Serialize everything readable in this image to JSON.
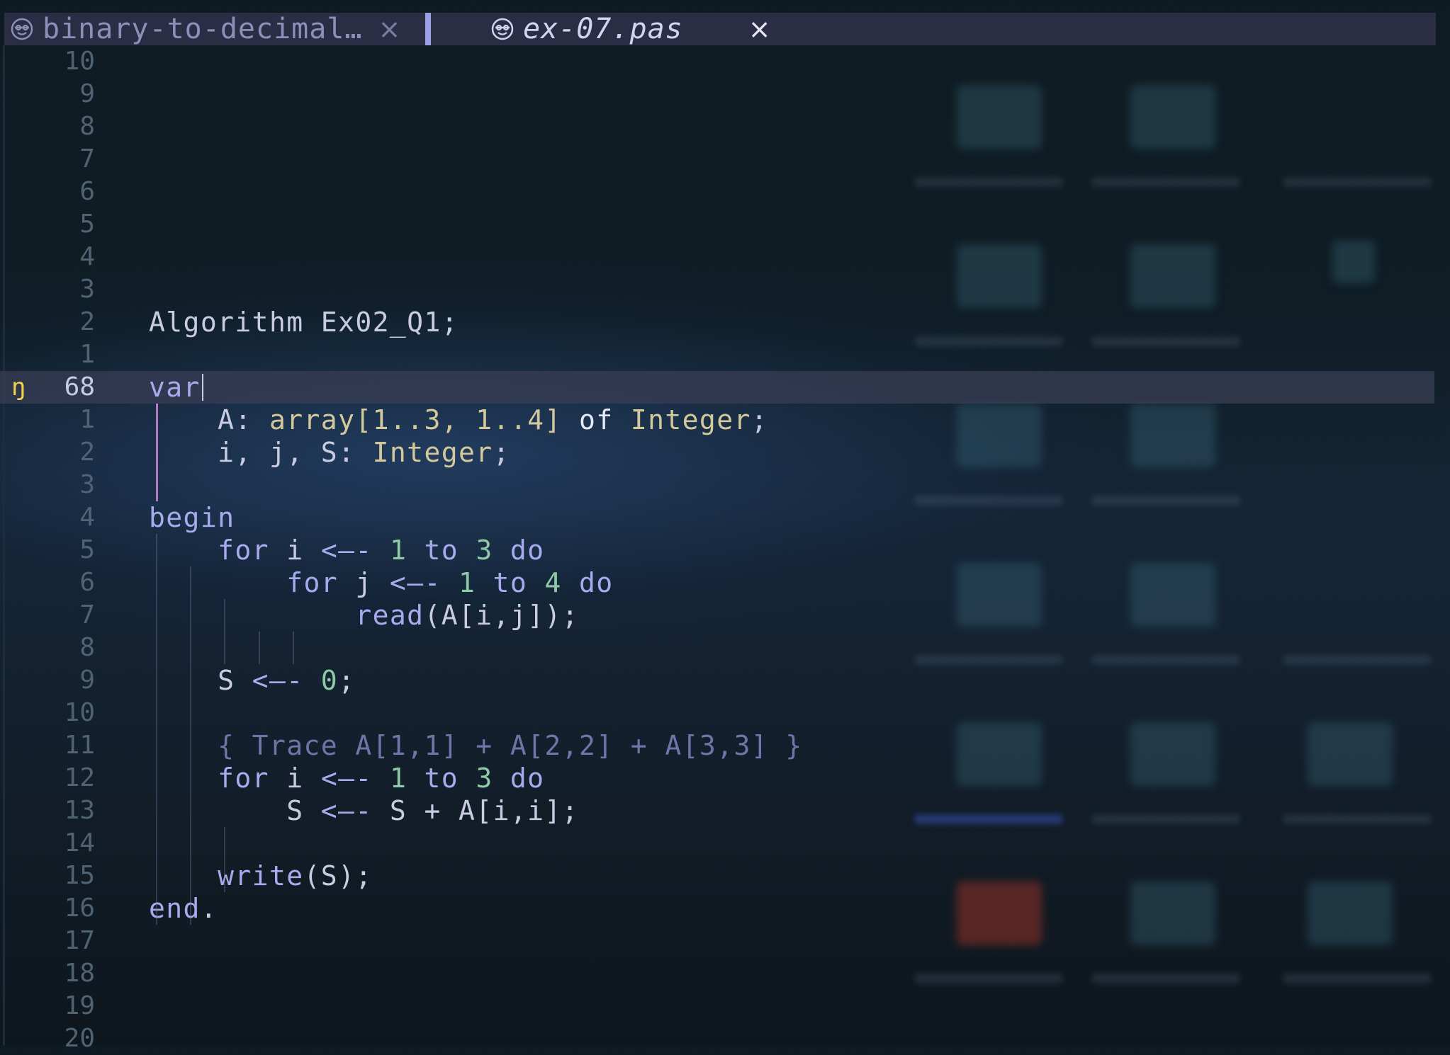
{
  "tabs": [
    {
      "label": "binary-to-decimal…",
      "close": "×",
      "active": false,
      "icon": "pascal-icon"
    },
    {
      "label": "ex-07.pas",
      "close": "×",
      "active": true,
      "icon": "pascal-icon"
    }
  ],
  "editor": {
    "current_line_marker": "ŋ",
    "lines": [
      {
        "num": "10",
        "tokens": []
      },
      {
        "num": "9",
        "tokens": []
      },
      {
        "num": "8",
        "tokens": []
      },
      {
        "num": "7",
        "tokens": []
      },
      {
        "num": "6",
        "tokens": []
      },
      {
        "num": "5",
        "tokens": []
      },
      {
        "num": "4",
        "tokens": []
      },
      {
        "num": "3",
        "tokens": []
      },
      {
        "num": "2",
        "tokens": [
          {
            "t": "Algorithm Ex02_Q1;",
            "c": "plain"
          }
        ]
      },
      {
        "num": "1",
        "tokens": []
      },
      {
        "num": "68",
        "current": true,
        "tokens": [
          {
            "t": "var",
            "c": "kw"
          }
        ]
      },
      {
        "num": "1",
        "tokens": [
          {
            "t": "    A: ",
            "c": "plain"
          },
          {
            "t": "array[1..3, 1..4]",
            "c": "type"
          },
          {
            "t": " ",
            "c": "plain"
          },
          {
            "t": "of",
            "c": "of"
          },
          {
            "t": " ",
            "c": "plain"
          },
          {
            "t": "Integer",
            "c": "type"
          },
          {
            "t": ";",
            "c": "plain"
          }
        ]
      },
      {
        "num": "2",
        "tokens": [
          {
            "t": "    i, j, S: ",
            "c": "plain"
          },
          {
            "t": "Integer",
            "c": "type"
          },
          {
            "t": ";",
            "c": "plain"
          }
        ]
      },
      {
        "num": "3",
        "tokens": []
      },
      {
        "num": "4",
        "tokens": [
          {
            "t": "begin",
            "c": "kw"
          }
        ]
      },
      {
        "num": "5",
        "tokens": [
          {
            "t": "    ",
            "c": "plain"
          },
          {
            "t": "for",
            "c": "kw"
          },
          {
            "t": " i ",
            "c": "plain"
          },
          {
            "t": "<—-",
            "c": "op"
          },
          {
            "t": " ",
            "c": "plain"
          },
          {
            "t": "1",
            "c": "num"
          },
          {
            "t": " ",
            "c": "plain"
          },
          {
            "t": "to",
            "c": "kw"
          },
          {
            "t": " ",
            "c": "plain"
          },
          {
            "t": "3",
            "c": "num"
          },
          {
            "t": " ",
            "c": "plain"
          },
          {
            "t": "do",
            "c": "kw"
          }
        ]
      },
      {
        "num": "6",
        "tokens": [
          {
            "t": "        ",
            "c": "plain"
          },
          {
            "t": "for",
            "c": "kw"
          },
          {
            "t": " j ",
            "c": "plain"
          },
          {
            "t": "<—-",
            "c": "op"
          },
          {
            "t": " ",
            "c": "plain"
          },
          {
            "t": "1",
            "c": "num"
          },
          {
            "t": " ",
            "c": "plain"
          },
          {
            "t": "to",
            "c": "kw"
          },
          {
            "t": " ",
            "c": "plain"
          },
          {
            "t": "4",
            "c": "num"
          },
          {
            "t": " ",
            "c": "plain"
          },
          {
            "t": "do",
            "c": "kw"
          }
        ]
      },
      {
        "num": "7",
        "tokens": [
          {
            "t": "            ",
            "c": "plain"
          },
          {
            "t": "read",
            "c": "kw"
          },
          {
            "t": "(A[i,j]);",
            "c": "plain"
          }
        ]
      },
      {
        "num": "8",
        "tokens": []
      },
      {
        "num": "9",
        "tokens": [
          {
            "t": "    S ",
            "c": "plain"
          },
          {
            "t": "<—-",
            "c": "op"
          },
          {
            "t": " ",
            "c": "plain"
          },
          {
            "t": "0",
            "c": "num"
          },
          {
            "t": ";",
            "c": "plain"
          }
        ]
      },
      {
        "num": "10",
        "tokens": []
      },
      {
        "num": "11",
        "tokens": [
          {
            "t": "    { Trace A[1,1] + A[2,2] + A[3,3] }",
            "c": "com"
          }
        ]
      },
      {
        "num": "12",
        "tokens": [
          {
            "t": "    ",
            "c": "plain"
          },
          {
            "t": "for",
            "c": "kw"
          },
          {
            "t": " i ",
            "c": "plain"
          },
          {
            "t": "<—-",
            "c": "op"
          },
          {
            "t": " ",
            "c": "plain"
          },
          {
            "t": "1",
            "c": "num"
          },
          {
            "t": " ",
            "c": "plain"
          },
          {
            "t": "to",
            "c": "kw"
          },
          {
            "t": " ",
            "c": "plain"
          },
          {
            "t": "3",
            "c": "num"
          },
          {
            "t": " ",
            "c": "plain"
          },
          {
            "t": "do",
            "c": "kw"
          }
        ]
      },
      {
        "num": "13",
        "tokens": [
          {
            "t": "        S ",
            "c": "plain"
          },
          {
            "t": "<—-",
            "c": "op"
          },
          {
            "t": " S + A[i,i];",
            "c": "plain"
          }
        ]
      },
      {
        "num": "14",
        "tokens": []
      },
      {
        "num": "15",
        "tokens": [
          {
            "t": "    ",
            "c": "plain"
          },
          {
            "t": "write",
            "c": "kw"
          },
          {
            "t": "(S);",
            "c": "plain"
          }
        ]
      },
      {
        "num": "16",
        "tokens": [
          {
            "t": "end",
            "c": "kw"
          },
          {
            "t": ".",
            "c": "plain"
          }
        ]
      },
      {
        "num": "17",
        "tokens": []
      },
      {
        "num": "18",
        "tokens": []
      },
      {
        "num": "19",
        "tokens": []
      },
      {
        "num": "20",
        "tokens": []
      }
    ]
  }
}
